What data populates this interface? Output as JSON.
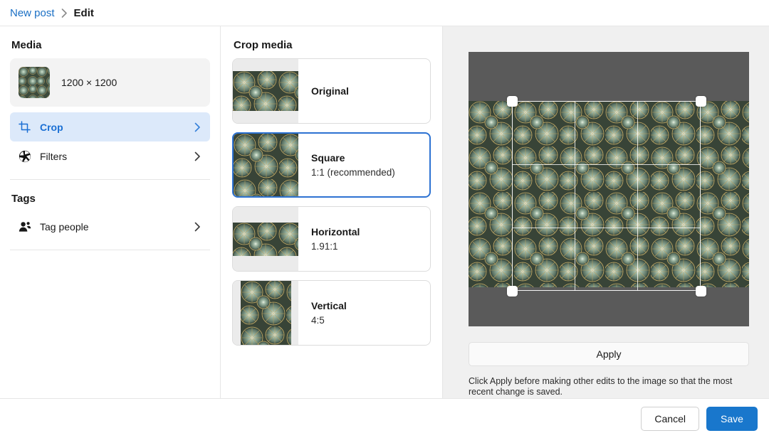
{
  "breadcrumb": {
    "parent": "New post",
    "separator": "›",
    "current": "Edit",
    "parent_icon": "breadcrumb-link",
    "separator_icon": "chevron-right-icon"
  },
  "sidebar": {
    "media_section_title": "Media",
    "media": {
      "dimensions": "1200 × 1200",
      "thumb_icon": "media-thumbnail"
    },
    "nav_items": [
      {
        "label": "Crop",
        "icon": "crop-icon",
        "chevron": "chevron-right-icon",
        "active": true
      },
      {
        "label": "Filters",
        "icon": "aperture-icon",
        "chevron": "chevron-right-icon",
        "active": false
      }
    ],
    "tags_section_title": "Tags",
    "tag_items": [
      {
        "label": "Tag people",
        "icon": "tag-person-icon",
        "chevron": "chevron-right-icon"
      }
    ]
  },
  "crop_panel": {
    "title": "Crop media",
    "options": [
      {
        "name": "Original",
        "ratio": "",
        "selected": false,
        "thumb_shape": "original"
      },
      {
        "name": "Square",
        "ratio": "1:1 (recommended)",
        "selected": true,
        "thumb_shape": "square"
      },
      {
        "name": "Horizontal",
        "ratio": "1.91:1",
        "selected": false,
        "thumb_shape": "horizontal"
      },
      {
        "name": "Vertical",
        "ratio": "4:5",
        "selected": false,
        "thumb_shape": "vertical"
      }
    ]
  },
  "preview": {
    "apply_label": "Apply",
    "help_text": "Click Apply before making other edits to the image so that the most recent change is saved.",
    "crop_overlay": {
      "handles": [
        "top-left",
        "top-right",
        "bottom-left",
        "bottom-right"
      ],
      "grid": "rule-of-thirds"
    }
  },
  "footer": {
    "cancel_label": "Cancel",
    "save_label": "Save"
  },
  "colors": {
    "accent_blue": "#1977cc",
    "link_blue": "#1a6fc4",
    "selected_row_bg": "#dce9fa",
    "selected_border": "#2d72d2",
    "panel_bg": "#f0f0f0",
    "stage_bg": "#5a5a5a"
  }
}
